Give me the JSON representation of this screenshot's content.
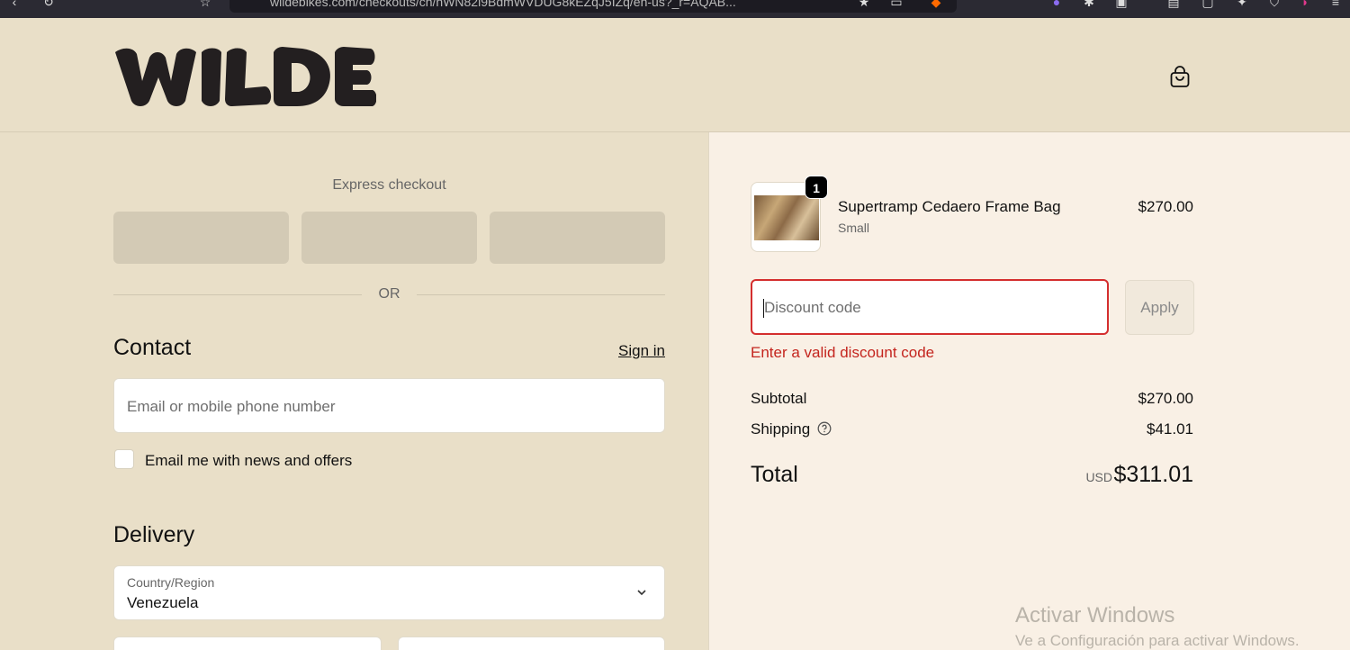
{
  "browser": {
    "url": "wildebikes.com/checkouts/cn/hWN82i9BdmWVDUG8kEZqJ5IZq/en-us?_r=AQAB..."
  },
  "header": {
    "logo_text": "WILDE",
    "cart_icon": "shopping-bag-icon"
  },
  "express": {
    "title": "Express checkout",
    "or_label": "OR"
  },
  "contact": {
    "heading": "Contact",
    "sign_in": "Sign in",
    "email_placeholder": "Email or mobile phone number",
    "newsletter_label": "Email me with news and offers"
  },
  "delivery": {
    "heading": "Delivery",
    "country_label": "Country/Region",
    "country_value": "Venezuela"
  },
  "order": {
    "item": {
      "quantity": "1",
      "name": "Supertramp Cedaero Frame Bag",
      "variant": "Small",
      "price": "$270.00"
    },
    "discount": {
      "placeholder": "Discount code",
      "apply_label": "Apply",
      "error": "Enter a valid discount code"
    },
    "subtotal_label": "Subtotal",
    "subtotal_value": "$270.00",
    "shipping_label": "Shipping",
    "shipping_value": "$41.01",
    "total_label": "Total",
    "currency": "USD",
    "total_value": "$311.01"
  },
  "watermark": {
    "line1": "Activar Windows",
    "line2": "Ve a Configuración para activar Windows."
  },
  "colors": {
    "left_bg": "#e9dfc8",
    "right_bg": "#f9f0e5",
    "error_red": "#c4251e"
  }
}
